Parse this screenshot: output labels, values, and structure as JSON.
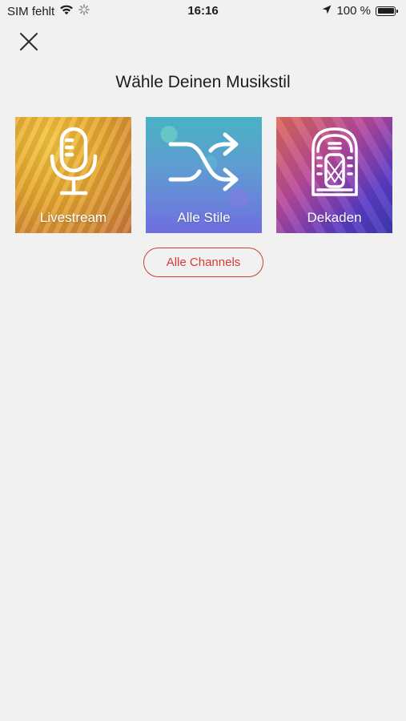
{
  "status_bar": {
    "carrier": "SIM fehlt",
    "time": "16:16",
    "battery": "100 %",
    "battery_level": 1.0,
    "icons": [
      "wifi-icon",
      "loading-icon",
      "location-arrow-icon",
      "battery-icon"
    ]
  },
  "header": {
    "close_icon": "close-icon",
    "title": "Wähle Deinen Musikstil"
  },
  "tiles": [
    {
      "label": "Livestream",
      "icon": "microphone-icon"
    },
    {
      "label": "Alle Stile",
      "icon": "shuffle-icon"
    },
    {
      "label": "Dekaden",
      "icon": "jukebox-icon"
    }
  ],
  "channels_button": {
    "label": "Alle Channels"
  },
  "colors": {
    "background": "#f1f1f2",
    "accent": "#d23c34",
    "text": "#1d1d1f"
  }
}
